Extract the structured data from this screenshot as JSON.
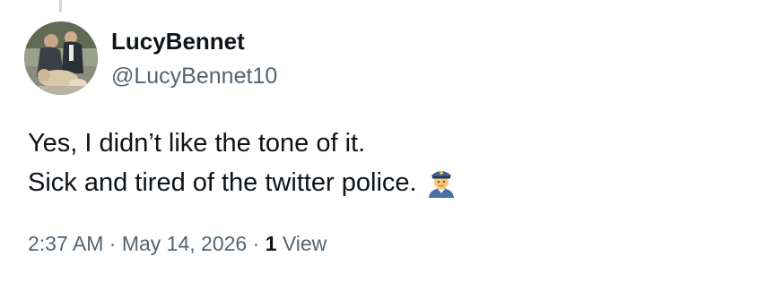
{
  "tweet": {
    "author": {
      "display_name": "LucyBennet",
      "handle": "@LucyBennet10",
      "avatar": "profile-photo"
    },
    "text_lines": [
      "Yes, I didn’t like the tone of it.",
      "Sick and tired of the twitter police."
    ],
    "emoji": "police-officer-icon",
    "meta": {
      "time": "2:37 AM",
      "separator_1": "·",
      "date": "May 14, 2026",
      "separator_2": "·",
      "views_count": "1",
      "views_label": "View"
    }
  },
  "colors": {
    "primary_text": "#0f1419",
    "secondary_text": "#536471",
    "thread_line": "#cfd9de",
    "background": "#ffffff"
  }
}
